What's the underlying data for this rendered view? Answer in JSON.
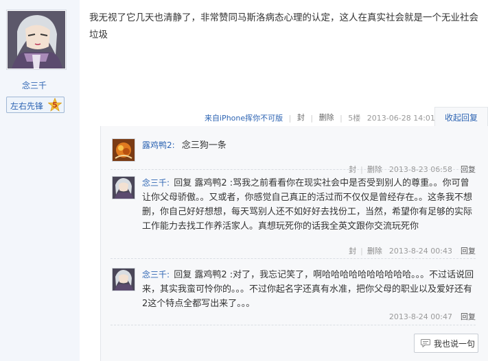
{
  "author": {
    "name": "念三千",
    "rank_label": "左右先锋",
    "level": "5"
  },
  "post": {
    "text": "我无视了它几天也清静了，非常赞同马斯洛病态心理的认定，这人在真实社会就是一个无业社会垃圾",
    "device": "来自iPhone挥你不可版",
    "seal": "封",
    "delete": "删除",
    "floor": "5楼",
    "time": "2013-06-28 14:01",
    "collapse_label": "收起回复"
  },
  "replies": [
    {
      "user": "露鸡鸭2:",
      "text": "念三狗一条",
      "seal": "封",
      "delete": "删除",
      "time": "2013-8-23 06:58",
      "reply_label": "回复",
      "avatar_icon": "orange-avatar-icon"
    },
    {
      "user": "念三千:",
      "text": "回复 露鸡鸭2 :骂我之前看看你在现实社会中是否受到别人的尊重。。你可曾让你父母骄傲。。又或者，你感觉自己真正的活过而不仅仅是曾经存在。。这条我不想删，你自己好好想想，每天骂别人还不如好好去找份工，当然，希望你有足够的实际工作能力去找工作养活家人。真想玩死你的话我全英文跟你交流玩死你",
      "seal": "封",
      "delete": "删除",
      "time": "2013-8-24 00:43",
      "reply_label": "回复",
      "avatar_icon": "silver-hair-avatar-icon"
    },
    {
      "user": "念三千:",
      "text": "回复 露鸡鸭2 :对了，我忘记笑了，啊哈哈哈哈哈哈哈哈哈哈。。。不过话说回来，其实我蛮可怜你的。。。不过你起名字还真有水准，把你父母的职业以及爱好还有2这个特点全都写出来了。。。",
      "time": "2013-8-24 00:47",
      "reply_label": "回复",
      "avatar_icon": "silver-hair-avatar-icon"
    }
  ],
  "say_button_label": "我也说一句"
}
